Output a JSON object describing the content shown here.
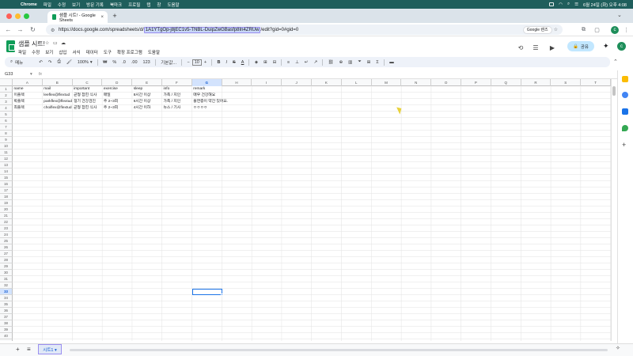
{
  "macbar": {
    "app": "Chrome",
    "menus": [
      "파일",
      "수정",
      "보기",
      "방문 기록",
      "북마크",
      "프로필",
      "탭",
      "창",
      "도움말"
    ],
    "datetime": "6월 24일 (화) 오후 4:08"
  },
  "browser": {
    "tab_title": "샘플 시트! - Google Sheets",
    "url_prefix": "https://docs.google.com/spreadsheets/d/",
    "url_highlight": "1A1YTgOp-j8jEC1v5-TNBL-DuipZwGBasfp8In4ZRUw",
    "url_suffix": "/edit?gid=0#gid=0",
    "lens_label": "Google 렌즈",
    "avatar": "c"
  },
  "sheets": {
    "title": "샘플 시트!",
    "menus": [
      "파일",
      "수정",
      "보기",
      "삽입",
      "서식",
      "데이터",
      "도구",
      "확장 프로그램",
      "도움말"
    ],
    "share_label": "공유",
    "avatar": "c"
  },
  "toolbar": {
    "search": "메뉴",
    "zoom": "100%",
    "currency": "₩",
    "percent": "%",
    "dec_less": ".0",
    "dec_more": ".00",
    "numfmt": "123",
    "font": "기본값...",
    "font_size": "10"
  },
  "formula_bar": {
    "name_box": "G33",
    "fx": "fx"
  },
  "grid": {
    "columns": [
      "A",
      "B",
      "C",
      "D",
      "E",
      "F",
      "G",
      "H",
      "I",
      "J",
      "K",
      "L",
      "M",
      "N",
      "O",
      "P",
      "Q",
      "R",
      "S",
      "T"
    ],
    "row_count": 41,
    "selected_row": "33",
    "selected_col": "G",
    "rows": [
      [
        "name",
        "mail",
        "important",
        "exercise",
        "sleep",
        "info",
        "remark"
      ],
      [
        "이플렉",
        "leeflex@flextud",
        "균형 잡힌 식사",
        "매일",
        "8시간 이상",
        "가족 / 지인",
        "매우 건강해요"
      ],
      [
        "박플렉",
        "parkflex@flextud",
        "정기 건강검진",
        "주 2~3회",
        "6시간 이상",
        "가족 / 지인",
        "불면증이 약간 있어요."
      ],
      [
        "최플렉",
        "choiflex@flextud",
        "균형 잡힌 식사",
        "주 2~3회",
        "4시간 이하",
        "뉴스 / 기사",
        "ㅇㅇㅇㅇ"
      ]
    ]
  },
  "bottom": {
    "add": "+",
    "list": "≡",
    "sheet_tab": "시트1 ▾"
  }
}
